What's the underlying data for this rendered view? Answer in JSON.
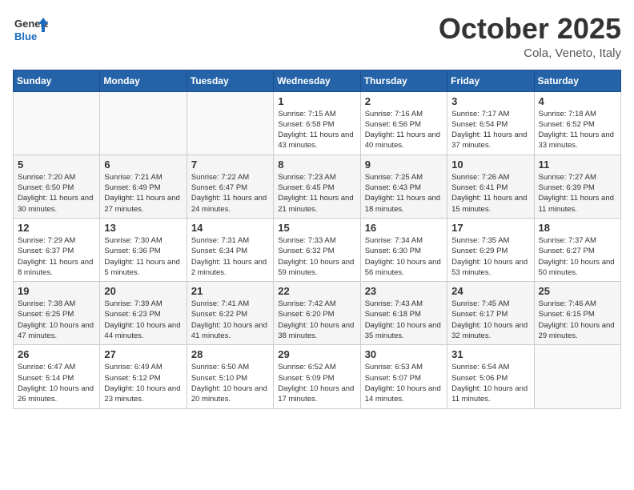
{
  "header": {
    "logo_general": "General",
    "logo_blue": "Blue",
    "month": "October 2025",
    "location": "Cola, Veneto, Italy"
  },
  "days_of_week": [
    "Sunday",
    "Monday",
    "Tuesday",
    "Wednesday",
    "Thursday",
    "Friday",
    "Saturday"
  ],
  "weeks": [
    [
      {
        "day": "",
        "info": ""
      },
      {
        "day": "",
        "info": ""
      },
      {
        "day": "",
        "info": ""
      },
      {
        "day": "1",
        "info": "Sunrise: 7:15 AM\nSunset: 6:58 PM\nDaylight: 11 hours and 43 minutes."
      },
      {
        "day": "2",
        "info": "Sunrise: 7:16 AM\nSunset: 6:56 PM\nDaylight: 11 hours and 40 minutes."
      },
      {
        "day": "3",
        "info": "Sunrise: 7:17 AM\nSunset: 6:54 PM\nDaylight: 11 hours and 37 minutes."
      },
      {
        "day": "4",
        "info": "Sunrise: 7:18 AM\nSunset: 6:52 PM\nDaylight: 11 hours and 33 minutes."
      }
    ],
    [
      {
        "day": "5",
        "info": "Sunrise: 7:20 AM\nSunset: 6:50 PM\nDaylight: 11 hours and 30 minutes."
      },
      {
        "day": "6",
        "info": "Sunrise: 7:21 AM\nSunset: 6:49 PM\nDaylight: 11 hours and 27 minutes."
      },
      {
        "day": "7",
        "info": "Sunrise: 7:22 AM\nSunset: 6:47 PM\nDaylight: 11 hours and 24 minutes."
      },
      {
        "day": "8",
        "info": "Sunrise: 7:23 AM\nSunset: 6:45 PM\nDaylight: 11 hours and 21 minutes."
      },
      {
        "day": "9",
        "info": "Sunrise: 7:25 AM\nSunset: 6:43 PM\nDaylight: 11 hours and 18 minutes."
      },
      {
        "day": "10",
        "info": "Sunrise: 7:26 AM\nSunset: 6:41 PM\nDaylight: 11 hours and 15 minutes."
      },
      {
        "day": "11",
        "info": "Sunrise: 7:27 AM\nSunset: 6:39 PM\nDaylight: 11 hours and 11 minutes."
      }
    ],
    [
      {
        "day": "12",
        "info": "Sunrise: 7:29 AM\nSunset: 6:37 PM\nDaylight: 11 hours and 8 minutes."
      },
      {
        "day": "13",
        "info": "Sunrise: 7:30 AM\nSunset: 6:36 PM\nDaylight: 11 hours and 5 minutes."
      },
      {
        "day": "14",
        "info": "Sunrise: 7:31 AM\nSunset: 6:34 PM\nDaylight: 11 hours and 2 minutes."
      },
      {
        "day": "15",
        "info": "Sunrise: 7:33 AM\nSunset: 6:32 PM\nDaylight: 10 hours and 59 minutes."
      },
      {
        "day": "16",
        "info": "Sunrise: 7:34 AM\nSunset: 6:30 PM\nDaylight: 10 hours and 56 minutes."
      },
      {
        "day": "17",
        "info": "Sunrise: 7:35 AM\nSunset: 6:29 PM\nDaylight: 10 hours and 53 minutes."
      },
      {
        "day": "18",
        "info": "Sunrise: 7:37 AM\nSunset: 6:27 PM\nDaylight: 10 hours and 50 minutes."
      }
    ],
    [
      {
        "day": "19",
        "info": "Sunrise: 7:38 AM\nSunset: 6:25 PM\nDaylight: 10 hours and 47 minutes."
      },
      {
        "day": "20",
        "info": "Sunrise: 7:39 AM\nSunset: 6:23 PM\nDaylight: 10 hours and 44 minutes."
      },
      {
        "day": "21",
        "info": "Sunrise: 7:41 AM\nSunset: 6:22 PM\nDaylight: 10 hours and 41 minutes."
      },
      {
        "day": "22",
        "info": "Sunrise: 7:42 AM\nSunset: 6:20 PM\nDaylight: 10 hours and 38 minutes."
      },
      {
        "day": "23",
        "info": "Sunrise: 7:43 AM\nSunset: 6:18 PM\nDaylight: 10 hours and 35 minutes."
      },
      {
        "day": "24",
        "info": "Sunrise: 7:45 AM\nSunset: 6:17 PM\nDaylight: 10 hours and 32 minutes."
      },
      {
        "day": "25",
        "info": "Sunrise: 7:46 AM\nSunset: 6:15 PM\nDaylight: 10 hours and 29 minutes."
      }
    ],
    [
      {
        "day": "26",
        "info": "Sunrise: 6:47 AM\nSunset: 5:14 PM\nDaylight: 10 hours and 26 minutes."
      },
      {
        "day": "27",
        "info": "Sunrise: 6:49 AM\nSunset: 5:12 PM\nDaylight: 10 hours and 23 minutes."
      },
      {
        "day": "28",
        "info": "Sunrise: 6:50 AM\nSunset: 5:10 PM\nDaylight: 10 hours and 20 minutes."
      },
      {
        "day": "29",
        "info": "Sunrise: 6:52 AM\nSunset: 5:09 PM\nDaylight: 10 hours and 17 minutes."
      },
      {
        "day": "30",
        "info": "Sunrise: 6:53 AM\nSunset: 5:07 PM\nDaylight: 10 hours and 14 minutes."
      },
      {
        "day": "31",
        "info": "Sunrise: 6:54 AM\nSunset: 5:06 PM\nDaylight: 10 hours and 11 minutes."
      },
      {
        "day": "",
        "info": ""
      }
    ]
  ]
}
